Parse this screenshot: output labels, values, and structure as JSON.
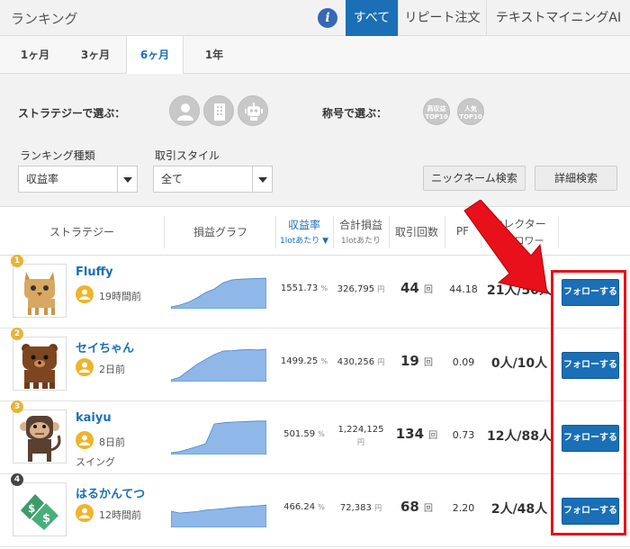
{
  "header": {
    "title": "ランキング",
    "info_icon": "info-icon",
    "tabs": [
      {
        "label": "すべて",
        "active": true
      },
      {
        "label": "リピート注文",
        "active": false
      },
      {
        "label": "テキストマイニングAI",
        "active": false
      }
    ]
  },
  "period_tabs": [
    {
      "label": "1ヶ月",
      "active": false
    },
    {
      "label": "3ヶ月",
      "active": false
    },
    {
      "label": "6ヶ月",
      "active": true
    },
    {
      "label": "1年",
      "active": false
    }
  ],
  "filter": {
    "strategy_label": "ストラテジーで選ぶ：",
    "strategy_icons": [
      "person-icon",
      "building-icon",
      "robot-icon"
    ],
    "title_label": "称号で選ぶ：",
    "title_badges": [
      {
        "line1": "高収益",
        "line2": "TOP10"
      },
      {
        "line1": "人気",
        "line2": "TOP10"
      }
    ],
    "ranking_type_label": "ランキング種類",
    "ranking_type_value": "収益率",
    "trade_style_label": "取引スタイル",
    "trade_style_value": "全て",
    "nickname_search": "ニックネーム検索",
    "detail_search": "詳細検索"
  },
  "columns": {
    "strategy": "ストラテジー",
    "pl_graph": "損益グラフ",
    "return_rate": "収益率",
    "return_rate_sub": "1lotあたり",
    "total_pl": "合計損益",
    "total_pl_sub": "1lotあたり",
    "trades": "取引回数",
    "pf": "PF",
    "follower": "セレクター",
    "follower_sub": "フォロワー"
  },
  "rows": [
    {
      "rank": "1",
      "name": "Fluffy",
      "time": "19時間前",
      "style": "",
      "rate": "1551.73",
      "rate_unit": "%",
      "profit": "326,795",
      "profit_unit": "円",
      "trades": "44",
      "trades_unit": "回",
      "pf": "44.18",
      "followers": "21人/50人",
      "button": "フォローする",
      "avatar": "lynx-avatar",
      "rank_color": "#e8b23a"
    },
    {
      "rank": "2",
      "name": "セイちゃん",
      "time": "2日前",
      "style": "",
      "rate": "1499.25",
      "rate_unit": "%",
      "profit": "430,256",
      "profit_unit": "円",
      "trades": "19",
      "trades_unit": "回",
      "pf": "0.09",
      "followers": "0人/10人",
      "button": "フォローする",
      "avatar": "bear-avatar",
      "rank_color": "#e8b23a"
    },
    {
      "rank": "3",
      "name": "kaiyu",
      "time": "8日前",
      "style": "スイング",
      "rate": "501.59",
      "rate_unit": "%",
      "profit": "1,224,125",
      "profit_unit": "円",
      "trades": "134",
      "trades_unit": "回",
      "pf": "0.73",
      "followers": "12人/88人",
      "button": "フォローする",
      "avatar": "monkey-avatar",
      "rank_color": "#e8b23a"
    },
    {
      "rank": "4",
      "name": "はるかんてつ",
      "time": "12時間前",
      "style": "",
      "rate": "466.24",
      "rate_unit": "%",
      "profit": "72,383",
      "profit_unit": "円",
      "trades": "68",
      "trades_unit": "回",
      "pf": "2.20",
      "followers": "2人/48人",
      "button": "フォローする",
      "avatar": "money-tag-avatar",
      "rank_color": "#444444"
    }
  ],
  "graphs": [
    [
      0.05,
      0.1,
      0.18,
      0.3,
      0.45,
      0.55,
      0.72,
      0.8,
      0.82,
      0.83,
      0.84,
      0.85
    ],
    [
      0.05,
      0.12,
      0.3,
      0.48,
      0.62,
      0.75,
      0.85,
      0.86,
      0.88,
      0.89,
      0.88,
      0.9
    ],
    [
      0.05,
      0.08,
      0.15,
      0.22,
      0.3,
      0.85,
      0.88,
      0.9,
      0.91,
      0.92,
      0.93,
      0.93
    ],
    [
      0.45,
      0.4,
      0.42,
      0.44,
      0.48,
      0.5,
      0.52,
      0.55,
      0.57,
      0.58,
      0.6,
      0.62
    ]
  ],
  "colors": {
    "accent": "#1a6fb6",
    "highlight": "#e8101a",
    "graph_fill": "#8fb8e8"
  }
}
